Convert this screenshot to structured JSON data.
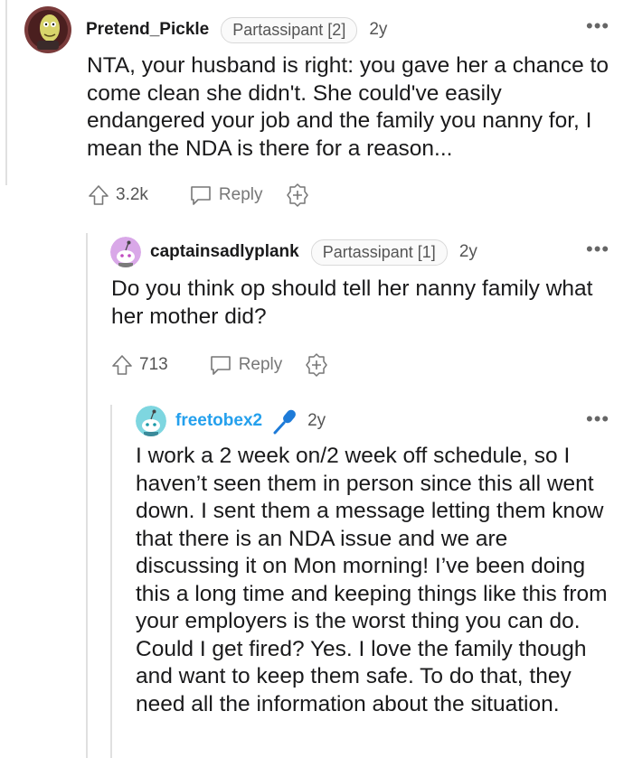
{
  "comments": [
    {
      "username": "Pretend_Pickle",
      "flair": "Partassipant [2]",
      "age": "2y",
      "more": "•••",
      "body": "NTA, your husband is right: you gave her a chance to come clean she didn't. She could've easily endangered your job and the family you nanny for, I mean the NDA is there for a reason...",
      "upvotes": "3.2k",
      "reply_label": "Reply"
    },
    {
      "username": "captainsadlyplank",
      "flair": "Partassipant [1]",
      "age": "2y",
      "more": "•••",
      "body": "Do you think op should tell her nanny family what her mother did?",
      "upvotes": "713",
      "reply_label": "Reply"
    },
    {
      "username": "freetobex2",
      "age": "2y",
      "more": "•••",
      "badge_icon": "microphone-icon",
      "username_color": "#24a0ed",
      "body": "I work a 2 week on/2 week off schedule, so I haven’t seen them in person since this all went down. I sent them a message letting them know that there is an NDA issue and we are discussing it on Mon morning! I’ve been doing this a long time and keeping things like this from your employers is the worst thing you can do. Could I get fired? Yes. I love the family though and want to keep them safe. To do that, they need all the information about the situation."
    }
  ]
}
